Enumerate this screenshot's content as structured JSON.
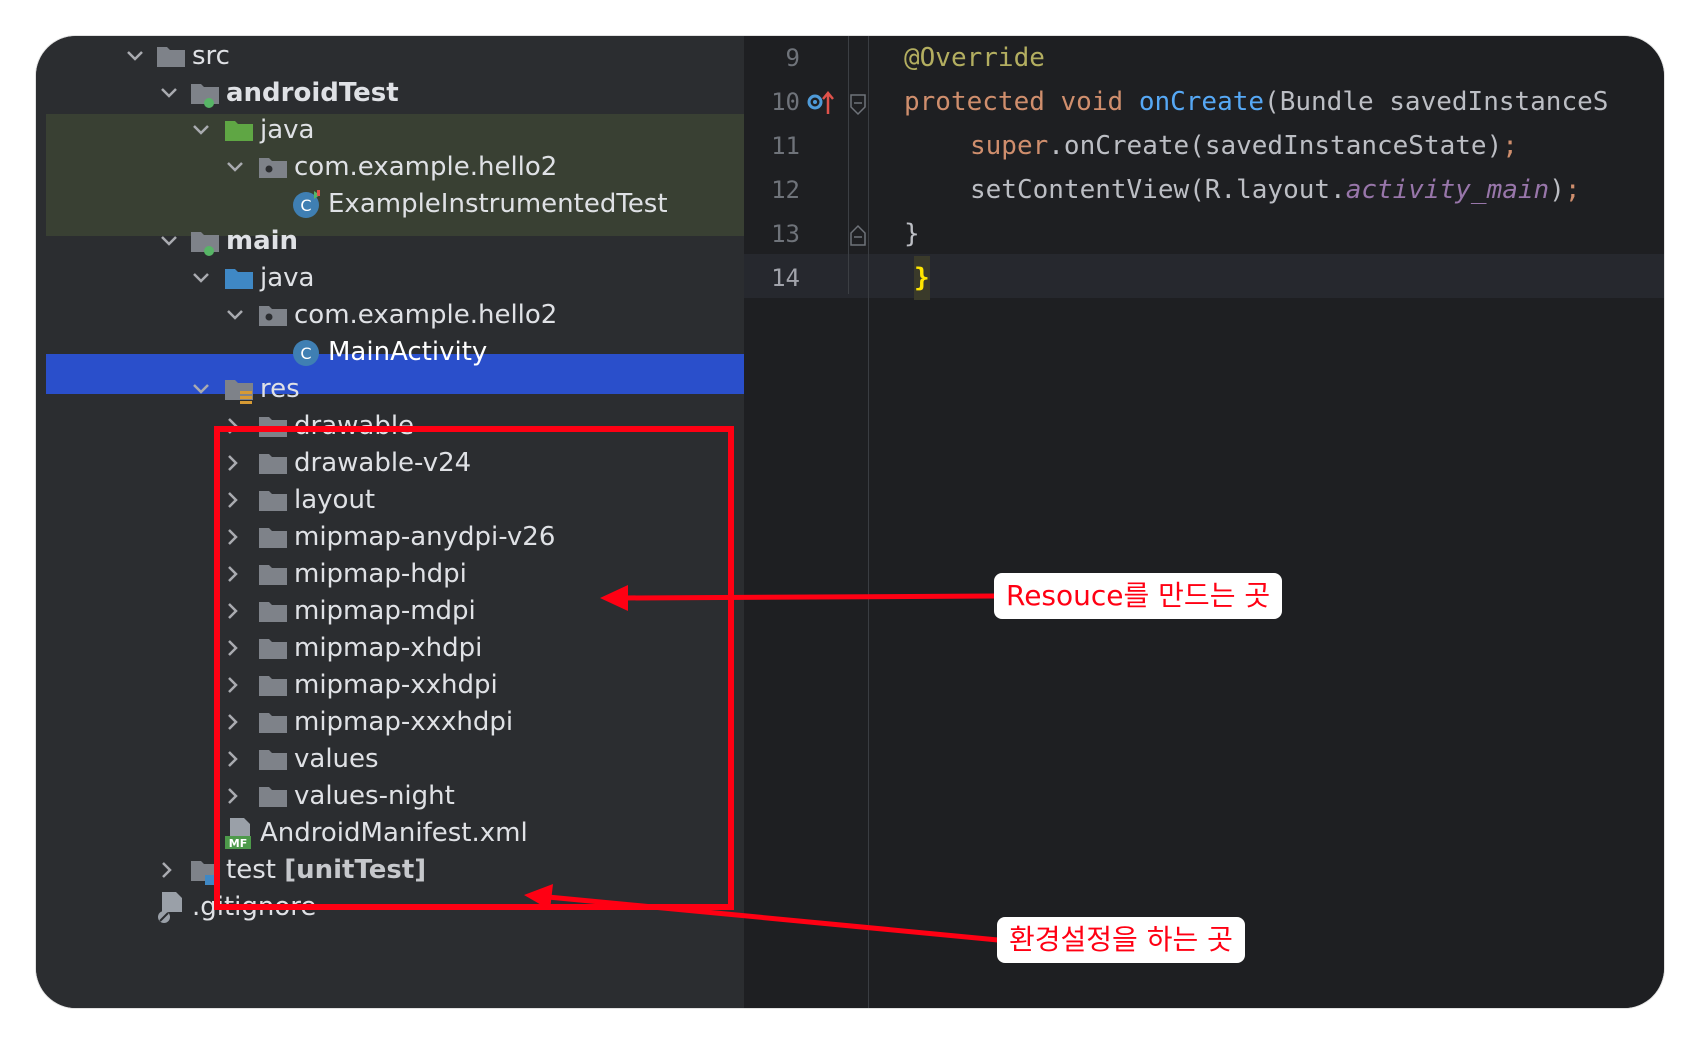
{
  "tree": {
    "items": [
      {
        "label": "src"
      },
      {
        "label": "androidTest"
      },
      {
        "label": "java"
      },
      {
        "label": "com.example.hello2"
      },
      {
        "label": "ExampleInstrumentedTest"
      },
      {
        "label": "main"
      },
      {
        "label": "java"
      },
      {
        "label": "com.example.hello2"
      },
      {
        "label": "MainActivity"
      },
      {
        "label": "res"
      },
      {
        "label": "drawable"
      },
      {
        "label": "drawable-v24"
      },
      {
        "label": "layout"
      },
      {
        "label": "mipmap-anydpi-v26"
      },
      {
        "label": "mipmap-hdpi"
      },
      {
        "label": "mipmap-mdpi"
      },
      {
        "label": "mipmap-xhdpi"
      },
      {
        "label": "mipmap-xxhdpi"
      },
      {
        "label": "mipmap-xxxhdpi"
      },
      {
        "label": "values"
      },
      {
        "label": "values-night"
      },
      {
        "label": "AndroidManifest.xml"
      },
      {
        "label": "test"
      },
      {
        "label": ".gitignore"
      }
    ],
    "test_suffix": "[unitTest]",
    "manifest_badge": "MF",
    "class_badge": "C"
  },
  "editor": {
    "line_numbers": [
      "9",
      "10",
      "11",
      "12",
      "13",
      "14"
    ],
    "lines": {
      "l9": "@Override",
      "l10_kw": "protected void ",
      "l10_fn": "onCreate",
      "l10_rest": "(Bundle savedInstanceS",
      "l11_kw": "super",
      "l11_rest": ".onCreate(savedInstanceState)",
      "l11_semi": ";",
      "l12_a": "setContentView(R.layout.",
      "l12_b": "activity_main",
      "l12_c": ")",
      "l12_semi": ";",
      "l13": "}",
      "l14": "}"
    }
  },
  "annotations": {
    "res_note": "Resouce를 만드는 곳",
    "manifest_note": "환경설정을 하는 곳"
  },
  "colors": {
    "highlight": "#ff0013",
    "selection": "#2a4fcb",
    "background": "#2b2d30"
  }
}
